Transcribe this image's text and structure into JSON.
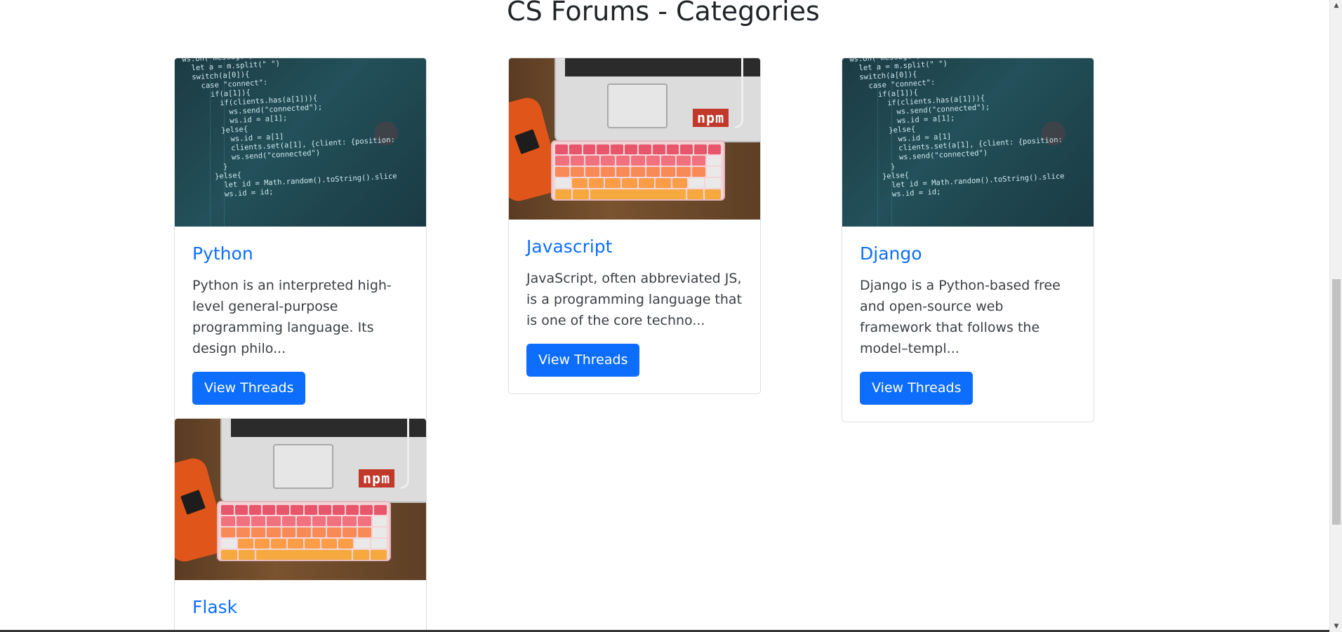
{
  "page": {
    "title": "CS Forums - Categories"
  },
  "categories": [
    {
      "name": "Python",
      "description": "Python is an interpreted high-level general-purpose programming language. Its design philo...",
      "button_label": "View Threads",
      "image": "code-screenshot-image"
    },
    {
      "name": "Javascript",
      "description": "JavaScript, often abbreviated JS, is a programming language that is one of the core techno...",
      "button_label": "View Threads",
      "image": "keyboard-laptop-image"
    },
    {
      "name": "Django",
      "description": "Django is a Python-based free and open-source web framework that follows the model–templ...",
      "button_label": "View Threads",
      "image": "code-screenshot-image"
    },
    {
      "name": "Flask",
      "description": "",
      "button_label": "",
      "image": "keyboard-laptop-image"
    }
  ],
  "code_image_text": "ws.on(\"message\", m => {\n  let a = m.split(\" \")\n  switch(a[0]){\n    case \"connect\":\n      if(a[1]){\n        if(clients.has(a[1])){\n          ws.send(\"connected\");\n          ws.id = a[1];\n        }else{\n          ws.id = a[1]\n          clients.set(a[1], {client: {position:\n          ws.send(\"connected\")\n        }\n      }else{\n        let id = Math.random().toString().slice\n        ws.id = id;",
  "colors": {
    "link": "#0d6efd",
    "button_bg": "#0d6efd",
    "button_text": "#ffffff",
    "title": "#212529"
  }
}
